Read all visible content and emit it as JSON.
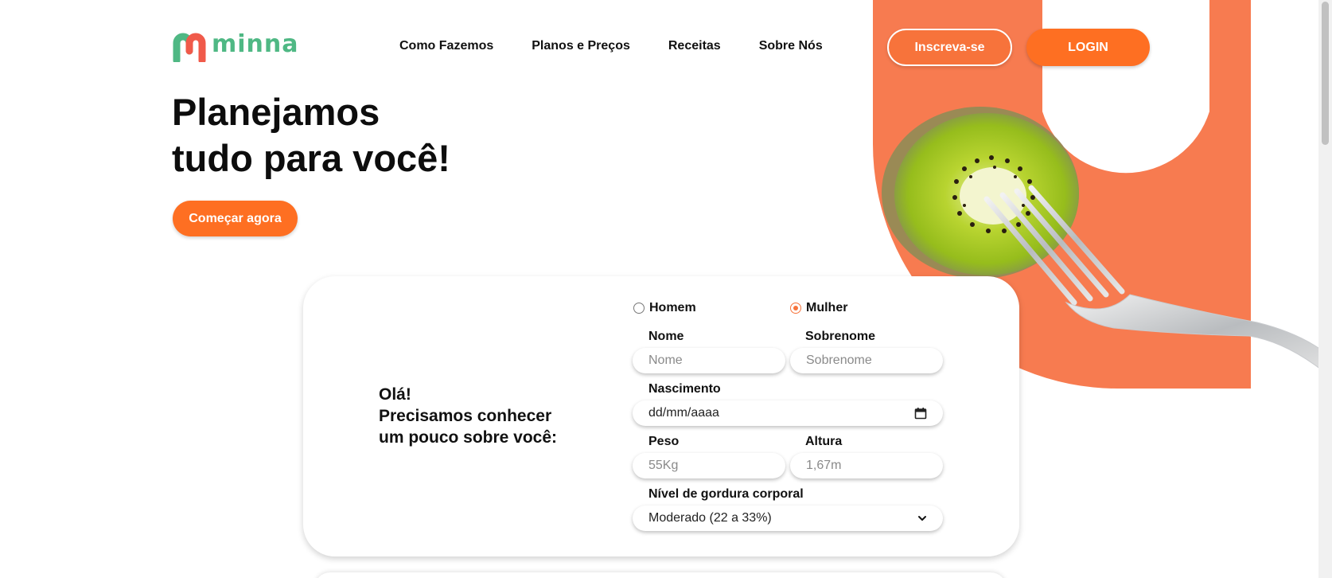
{
  "brand": {
    "name": "minna",
    "accent": "#fe6f22",
    "logo_green": "#4fb884",
    "logo_red": "#f05a4a"
  },
  "nav": {
    "items": [
      "Como Fazemos",
      "Planos e Preços",
      "Receitas",
      "Sobre Nós"
    ],
    "signup_label": "Inscreva-se",
    "login_label": "LOGIN"
  },
  "hero": {
    "title_line1": "Planejamos",
    "title_line2": "tudo para você!",
    "cta_label": "Começar agora"
  },
  "form": {
    "intro_line1": "Olá!",
    "intro_line2": "Precisamos conhecer",
    "intro_line3": "um pouco sobre você:",
    "gender_options": [
      "Homem",
      "Mulher"
    ],
    "gender_selected": "Mulher",
    "nome_label": "Nome",
    "nome_placeholder": "Nome",
    "sobrenome_label": "Sobrenome",
    "sobrenome_placeholder": "Sobrenome",
    "nascimento_label": "Nascimento",
    "nascimento_placeholder": "dd/mm/aaaa",
    "peso_label": "Peso",
    "peso_placeholder": "55Kg",
    "altura_label": "Altura",
    "altura_placeholder": "1,67m",
    "gordura_label": "Nível de gordura corporal",
    "gordura_value": "Moderado (22 a 33%)"
  },
  "icons": {
    "calendar": "calendar-icon",
    "chevron": "chevron-down-icon"
  },
  "decor_color": "#f77b50"
}
